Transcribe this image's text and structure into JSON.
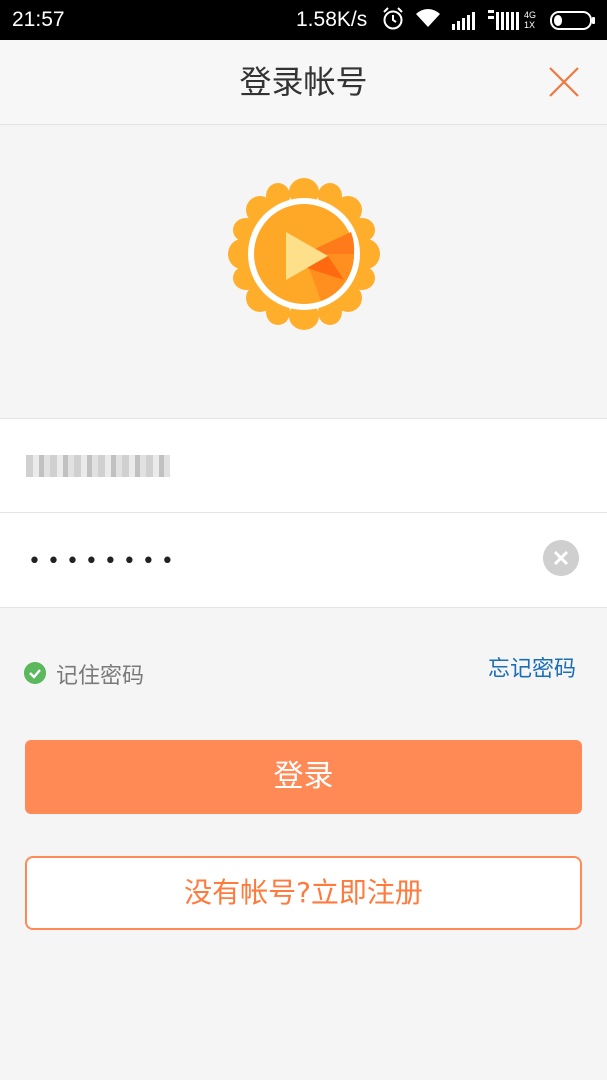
{
  "status_bar": {
    "time": "21:57",
    "net_speed": "1.58K/s",
    "network_type_top": "4G",
    "network_type_bottom": "1X",
    "icons": [
      "alarm-icon",
      "wifi-icon",
      "signal-icon",
      "signal-icon-2",
      "battery-icon"
    ]
  },
  "header": {
    "title": "登录帐号",
    "close_icon": "close-icon"
  },
  "logo": {
    "icon": "sunflower-play-logo"
  },
  "form": {
    "username_value": "",
    "password_value": "••••••••",
    "clear_icon": "clear-icon"
  },
  "options": {
    "remember_label": "记住密码",
    "remember_checked": true,
    "forgot_label": "忘记密码"
  },
  "actions": {
    "login_label": "登录",
    "register_label": "没有帐号?立即注册"
  },
  "colors": {
    "accent": "#ff8a56",
    "link": "#1a6eb8",
    "check": "#5cb85c"
  }
}
